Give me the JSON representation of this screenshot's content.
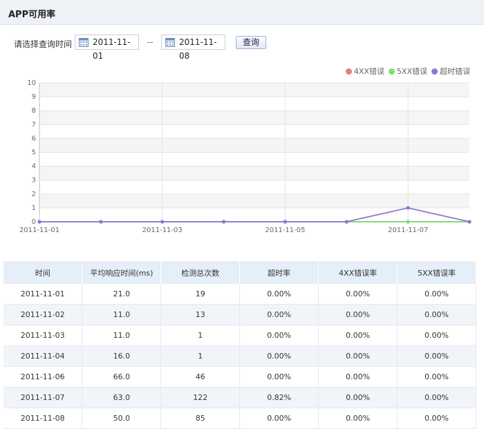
{
  "header": {
    "title": "APP可用率"
  },
  "query": {
    "label": "请选择查询时间",
    "start_date": "2011-11-01",
    "separator": "--",
    "end_date": "2011-11-08",
    "button_label": "查询"
  },
  "colors": {
    "series_4xx": "#e87b85",
    "series_5xx": "#77e077",
    "series_timeout": "#8b78d6"
  },
  "chart_data": {
    "type": "line",
    "x": [
      "2011-11-01",
      "2011-11-02",
      "2011-11-03",
      "2011-11-04",
      "2011-11-05",
      "2011-11-06",
      "2011-11-07",
      "2011-11-08"
    ],
    "x_tick_labels": [
      "2011-11-01",
      "2011-11-03",
      "2011-11-05",
      "2011-11-07"
    ],
    "y_ticks": [
      0,
      1,
      2,
      3,
      4,
      5,
      6,
      7,
      8,
      9,
      10
    ],
    "ylim": [
      0,
      10
    ],
    "grid": true,
    "legend_position": "top-right",
    "series": [
      {
        "name": "4XX错误",
        "values": [
          0,
          0,
          0,
          0,
          0,
          0,
          0,
          0
        ]
      },
      {
        "name": "5XX错误",
        "values": [
          0,
          0,
          0,
          0,
          0,
          0,
          0,
          0
        ]
      },
      {
        "name": "超时错误",
        "values": [
          0,
          0,
          0,
          0,
          0,
          0,
          1,
          0
        ]
      }
    ]
  },
  "table": {
    "headers": [
      "时间",
      "平均响应时间(ms)",
      "检测总次数",
      "超时率",
      "4XX错误率",
      "5XX错误率"
    ],
    "rows": [
      [
        "2011-11-01",
        "21.0",
        "19",
        "0.00%",
        "0.00%",
        "0.00%"
      ],
      [
        "2011-11-02",
        "11.0",
        "13",
        "0.00%",
        "0.00%",
        "0.00%"
      ],
      [
        "2011-11-03",
        "11.0",
        "1",
        "0.00%",
        "0.00%",
        "0.00%"
      ],
      [
        "2011-11-04",
        "16.0",
        "1",
        "0.00%",
        "0.00%",
        "0.00%"
      ],
      [
        "2011-11-06",
        "66.0",
        "46",
        "0.00%",
        "0.00%",
        "0.00%"
      ],
      [
        "2011-11-07",
        "63.0",
        "122",
        "0.82%",
        "0.00%",
        "0.00%"
      ],
      [
        "2011-11-08",
        "50.0",
        "85",
        "0.00%",
        "0.00%",
        "0.00%"
      ]
    ]
  }
}
